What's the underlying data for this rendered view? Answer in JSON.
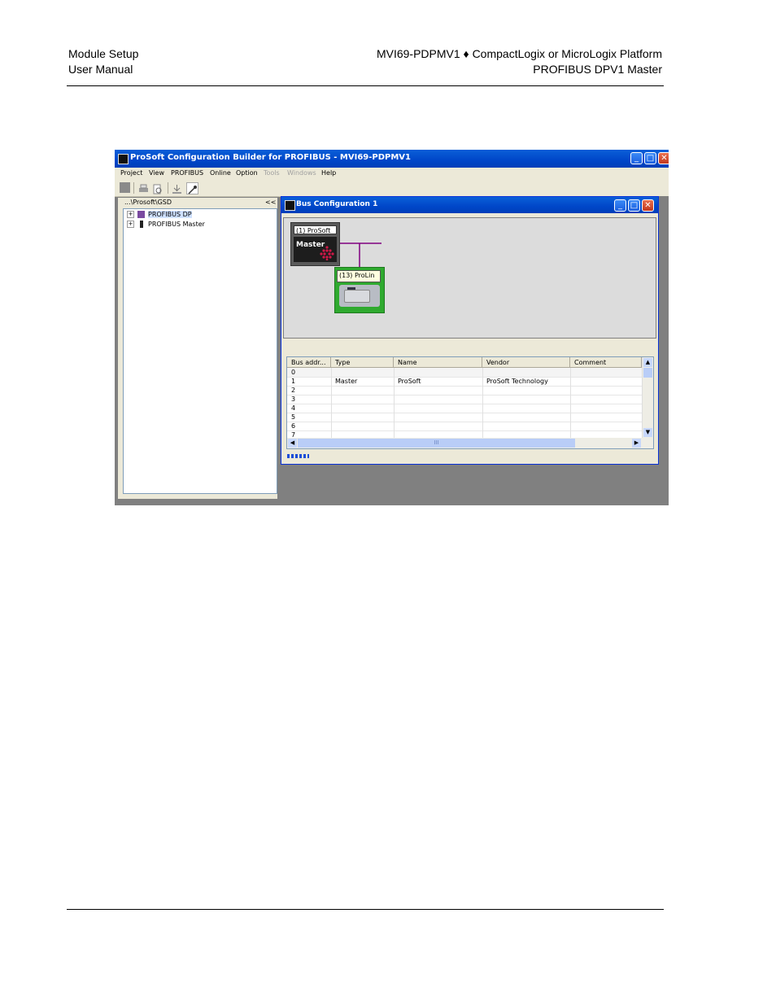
{
  "header": {
    "left_line1": "Module Setup",
    "left_line2": "User Manual",
    "right_line1": "MVI69-PDPMV1 ♦ CompactLogix or MicroLogix Platform",
    "right_line2": "PROFIBUS DPV1 Master"
  },
  "app": {
    "title": "ProSoft Configuration Builder for PROFIBUS - MVI69-PDPMV1",
    "menu": [
      "Project",
      "View",
      "PROFIBUS",
      "Online",
      "Option",
      "Tools",
      "Windows",
      "Help"
    ],
    "disabled_menu": [
      "Tools",
      "Windows"
    ]
  },
  "left_pane": {
    "path": "...\\Prosoft\\GSD",
    "collapse": "<<",
    "tree": [
      "PROFIBUS DP",
      "PROFIBUS Master"
    ]
  },
  "bus_window": {
    "title": "Bus Configuration 1",
    "master_label": "(1) ProSoft",
    "master_text": "Master",
    "slave_label": "(13) ProLin"
  },
  "grid": {
    "columns": [
      "Bus addr...",
      "Type",
      "Name",
      "Vendor",
      "Comment"
    ],
    "rows": [
      [
        "0",
        "",
        "",
        "",
        ""
      ],
      [
        "1",
        "Master",
        "ProSoft",
        "ProSoft Technology",
        ""
      ],
      [
        "2",
        "",
        "",
        "",
        ""
      ],
      [
        "3",
        "",
        "",
        "",
        ""
      ],
      [
        "4",
        "",
        "",
        "",
        ""
      ],
      [
        "5",
        "",
        "",
        "",
        ""
      ],
      [
        "6",
        "",
        "",
        "",
        ""
      ],
      [
        "7",
        "",
        "",
        "",
        ""
      ]
    ],
    "hscroll_grip": "III"
  },
  "colors": {
    "titlebar": "#0046c8",
    "master_block": "#1d1d1d",
    "slave_block": "#2faa2f",
    "bus_line": "#800080"
  }
}
